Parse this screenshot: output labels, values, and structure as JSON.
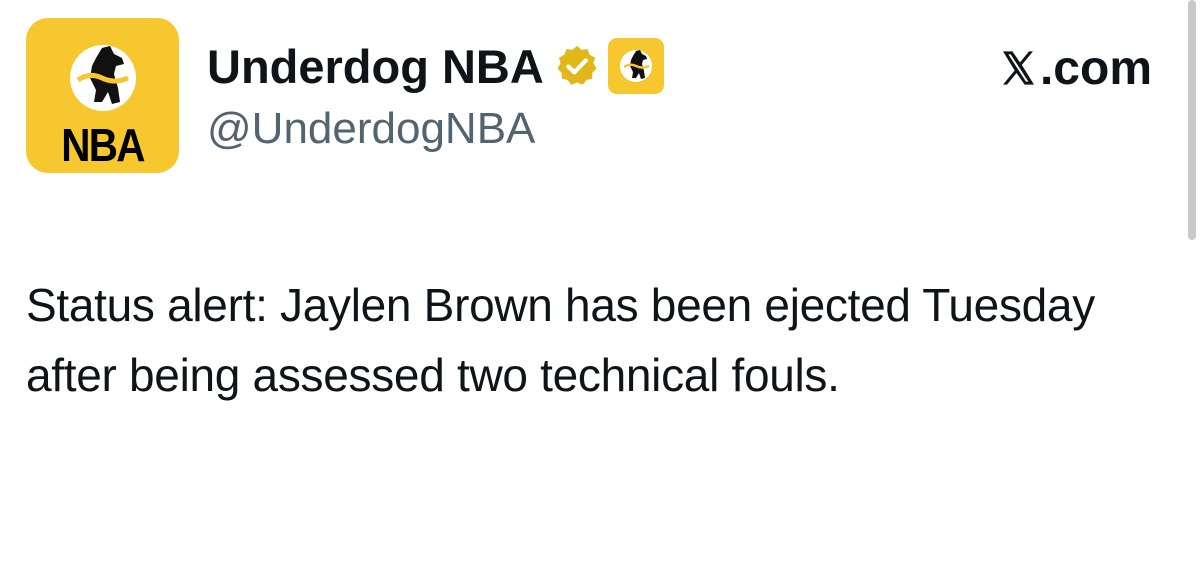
{
  "account": {
    "display_name": "Underdog NBA",
    "handle": "@UnderdogNBA",
    "avatar_text": "NBA",
    "verified_icon": "verified-badge-gold-icon",
    "affiliate_icon": "underdog-dog-logo-icon"
  },
  "brand": {
    "label": ".com",
    "icon": "x-logo-icon"
  },
  "tweet": {
    "text": "Status alert: Jaylen Brown has been ejected Tuesday after being assessed two technical fouls."
  },
  "colors": {
    "brand_yellow": "#f6c72f",
    "verified_gold": "#e2b719",
    "text_primary": "#0f1419",
    "text_secondary": "#536471"
  }
}
